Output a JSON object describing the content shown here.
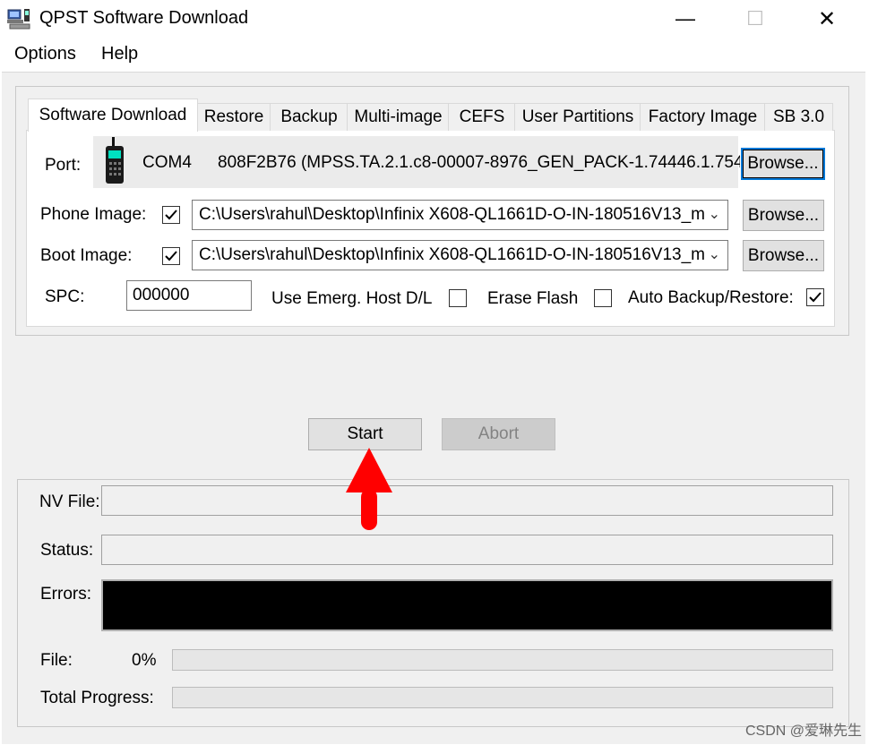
{
  "window": {
    "title": "QPST Software Download",
    "minimize_glyph": "—",
    "maximize_glyph": "☐",
    "close_glyph": "✕"
  },
  "menu": [
    "Options",
    "Help"
  ],
  "tabs": [
    "Software Download",
    "Restore",
    "Backup",
    "Multi-image",
    "CEFS",
    "User Partitions",
    "Factory Image",
    "SB 3.0"
  ],
  "port": {
    "label": "Port:",
    "com": "COM4",
    "device": "808F2B76  (MPSS.TA.2.1.c8-00007-8976_GEN_PACK-1.74446.1.754",
    "browse_label": "Browse..."
  },
  "phone_image": {
    "label": "Phone Image:",
    "checked": true,
    "path": "C:\\Users\\rahul\\Desktop\\Infinix X608-QL1661D-O-IN-180516V13_m",
    "browse_label": "Browse..."
  },
  "boot_image": {
    "label": "Boot Image:",
    "checked": true,
    "path": "C:\\Users\\rahul\\Desktop\\Infinix X608-QL1661D-O-IN-180516V13_m",
    "browse_label": "Browse..."
  },
  "spc": {
    "label": "SPC:",
    "value": "000000"
  },
  "options": {
    "emerg_label": "Use Emerg. Host D/L",
    "emerg_checked": false,
    "erase_label": "Erase Flash",
    "erase_checked": false,
    "autobackup_label": "Auto Backup/Restore:",
    "autobackup_checked": true
  },
  "actions": {
    "start_label": "Start",
    "abort_label": "Abort"
  },
  "status_area": {
    "nv_file_label": "NV File:",
    "status_label": "Status:",
    "errors_label": "Errors:",
    "file_label": "File:",
    "file_percent": "0%",
    "file_progress": 0,
    "total_label": "Total Progress:",
    "total_progress": 0
  },
  "watermark": "CSDN @爱琳先生",
  "colors": {
    "arrow": "#ff0000",
    "errors_bg": "#000000",
    "focus": "#0078d7"
  }
}
